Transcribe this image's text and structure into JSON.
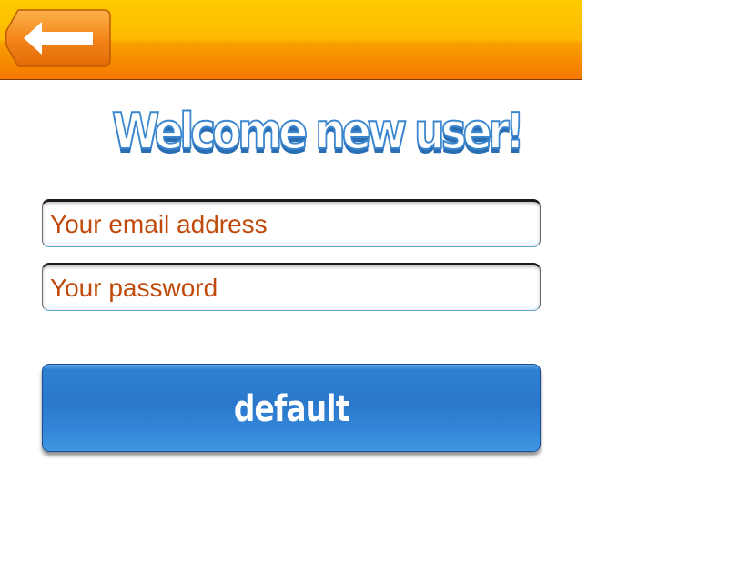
{
  "topbar": {
    "back_icon": "arrow-left-icon",
    "colors": {
      "bar_top": "#ffcc00",
      "bar_bottom": "#f47800",
      "button_fill": "#f07a10",
      "button_border": "#c05a00"
    }
  },
  "welcome": {
    "title": "Welcome new user!",
    "color": "#3a86cf"
  },
  "form": {
    "email_placeholder": "Your email address",
    "email_value": "",
    "password_placeholder": "Your password",
    "password_value": "",
    "placeholder_color": "#c04a0a"
  },
  "submit": {
    "label": "default",
    "color": "#2a78cc"
  }
}
